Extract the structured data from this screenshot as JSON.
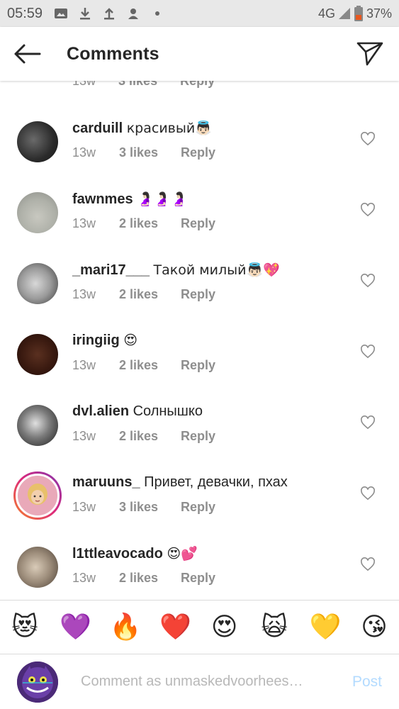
{
  "status_bar": {
    "time": "05:59",
    "network": "4G",
    "battery": "37%",
    "icons": [
      "image-icon",
      "download-icon",
      "upload-icon",
      "person-icon",
      "dot-icon"
    ]
  },
  "header": {
    "title": "Comments"
  },
  "partial_comment": {
    "time": "13w",
    "likes": "3 likes",
    "reply": "Reply"
  },
  "comments": [
    {
      "username": "carduill",
      "text": "красивый👼🏻",
      "time": "13w",
      "likes": "3 likes",
      "reply": "Reply"
    },
    {
      "username": "fawnmes",
      "text": "🤰🏻🤰🏻🤰🏻",
      "time": "13w",
      "likes": "2 likes",
      "reply": "Reply"
    },
    {
      "username": "_mari17___",
      "text": "Такой милый👼🏻💖",
      "time": "13w",
      "likes": "2 likes",
      "reply": "Reply"
    },
    {
      "username": "iringiig",
      "text": "😍",
      "time": "13w",
      "likes": "2 likes",
      "reply": "Reply"
    },
    {
      "username": "dvl.alien",
      "text": "Солнышко",
      "time": "13w",
      "likes": "2 likes",
      "reply": "Reply"
    },
    {
      "username": "maruuns_",
      "text": "Привет, девачки, пхах",
      "time": "13w",
      "likes": "3 likes",
      "reply": "Reply",
      "story_ring": true
    },
    {
      "username": "l1ttleavocado",
      "text": "😍💕",
      "time": "13w",
      "likes": "2 likes",
      "reply": "Reply"
    }
  ],
  "emoji_bar": [
    "😻",
    "💜",
    "🔥",
    "❤️",
    "😍",
    "🙀",
    "💛",
    "😘"
  ],
  "comment_input": {
    "placeholder": "Comment as unmaskedvoorhees…",
    "post_label": "Post"
  },
  "colors": {
    "accent_disabled": "#b3dbff",
    "text_secondary": "#8e8e8e",
    "status_bar_bg": "#e8e8e8"
  }
}
